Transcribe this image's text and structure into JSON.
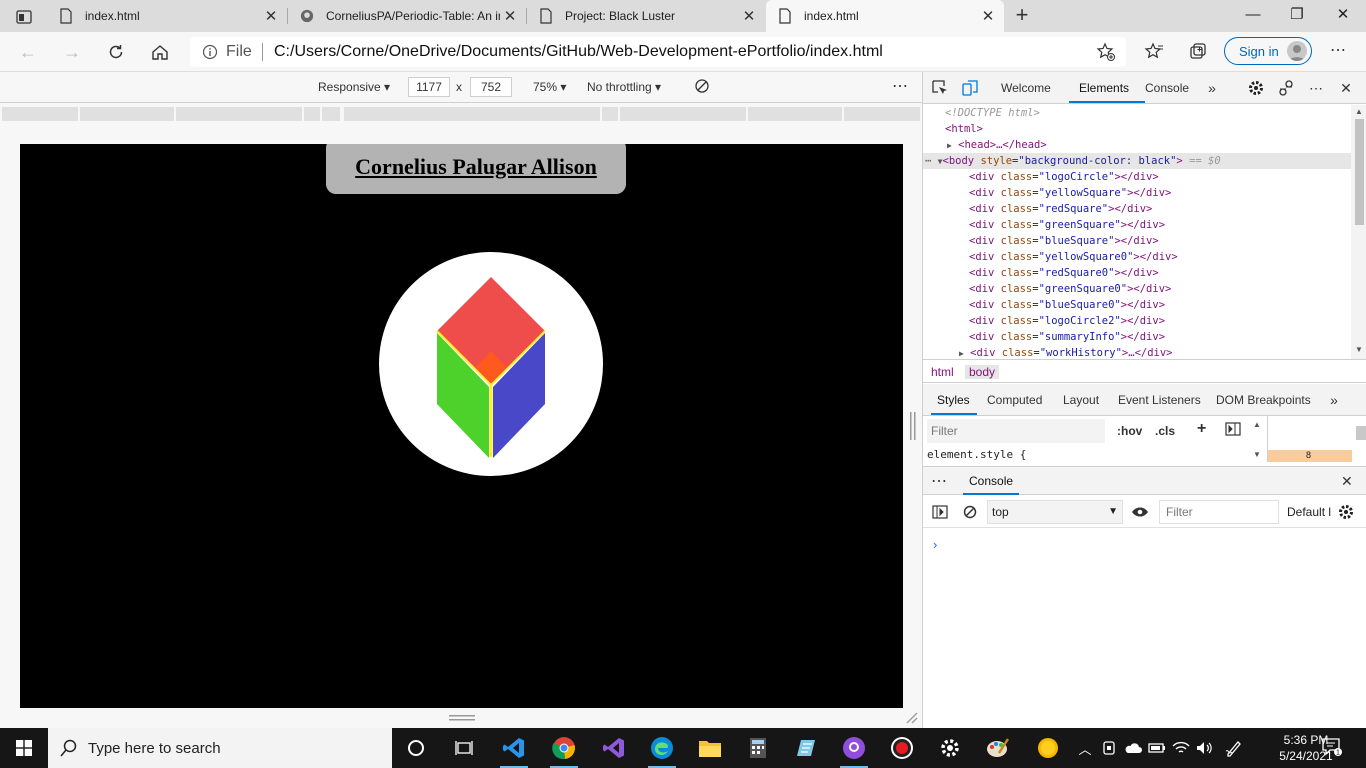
{
  "browser": {
    "tabs": [
      {
        "title": "index.html",
        "icon": "file-icon",
        "active": false
      },
      {
        "title": "CorneliusPA/Periodic-Table: An in",
        "icon": "github-icon",
        "active": false
      },
      {
        "title": "Project: Black Luster",
        "icon": "file-icon",
        "active": false
      },
      {
        "title": "index.html",
        "icon": "file-icon",
        "active": true
      }
    ],
    "address": {
      "scheme_label": "File",
      "url": "C:/Users/Corne/OneDrive/Documents/GitHub/Web-Development-ePortfolio/index.html"
    },
    "signin_label": "Sign in"
  },
  "device_toolbar": {
    "mode": "Responsive",
    "width": "1177",
    "times": "x",
    "height": "752",
    "zoom": "75%",
    "throttling": "No throttling"
  },
  "page": {
    "name_heading": "Cornelius Palugar Allison",
    "background_color": "#000000",
    "header_box_color": "#b3b3b3",
    "logo_colors": {
      "circle": "#ffffff",
      "top": "#ef4c4c",
      "left": "#4dd12b",
      "right": "#4848c8",
      "edge": "#ffee22",
      "center": "#ff5a1e"
    }
  },
  "devtools": {
    "tabs": [
      "Welcome",
      "Elements",
      "Console"
    ],
    "active_tab": "Elements",
    "dom": {
      "doctype": "<!DOCTYPE html>",
      "html_open": "<html>",
      "head": "<head>…</head>",
      "body_tag": "body",
      "body_attr_name": "style",
      "body_attr_value": "\"background-color: black\"",
      "body_marker": "== $0",
      "children": [
        {
          "class": "logoCircle",
          "collapsed": false
        },
        {
          "class": "yellowSquare",
          "collapsed": false
        },
        {
          "class": "redSquare",
          "collapsed": false
        },
        {
          "class": "greenSquare",
          "collapsed": false
        },
        {
          "class": "blueSquare",
          "collapsed": false
        },
        {
          "class": "yellowSquare0",
          "collapsed": false
        },
        {
          "class": "redSquare0",
          "collapsed": false
        },
        {
          "class": "greenSquare0",
          "collapsed": false
        },
        {
          "class": "blueSquare0",
          "collapsed": false
        },
        {
          "class": "logoCircle2",
          "collapsed": false
        },
        {
          "class": "summaryInfo",
          "collapsed": false
        },
        {
          "class": "workHistory",
          "collapsed": true
        }
      ]
    },
    "breadcrumbs": [
      "html",
      "body"
    ],
    "pane_tabs": [
      "Styles",
      "Computed",
      "Layout",
      "Event Listeners",
      "DOM Breakpoints"
    ],
    "styles": {
      "filter_placeholder": "Filter",
      "hov_label": ":hov",
      "cls_label": ".cls",
      "element_style": "element.style {",
      "box_value": "8"
    },
    "drawer": {
      "tab": "Console",
      "context": "top",
      "filter_placeholder": "Filter",
      "levels": "Default l",
      "prompt": "›"
    }
  },
  "taskbar": {
    "search_placeholder": "Type here to search",
    "time": "5:36 PM",
    "date": "5/24/2021"
  }
}
